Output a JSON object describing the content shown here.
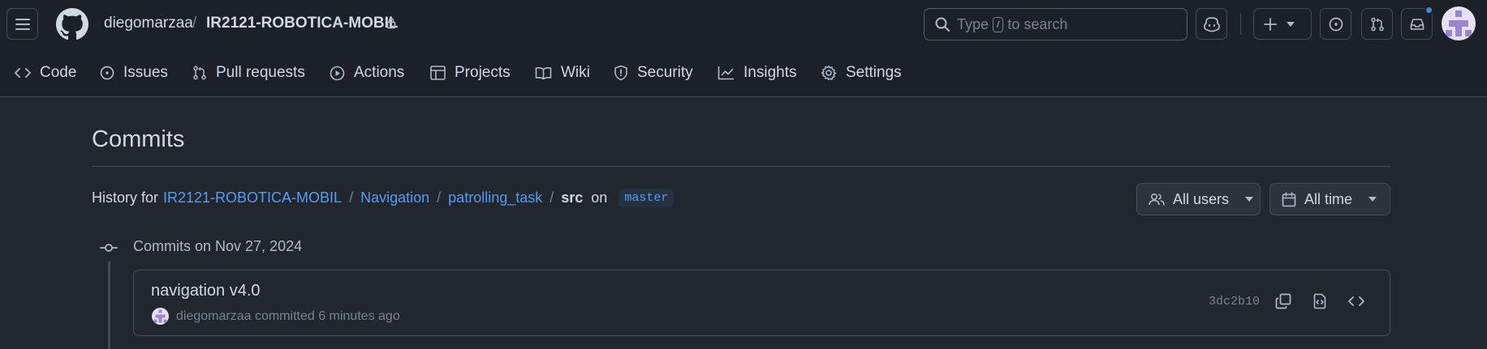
{
  "header": {
    "owner": "diegomarzaa",
    "separator": "/",
    "repo": "IR2121-ROBOTICA-MOBIL",
    "search_prefix": "Type",
    "search_key": "/",
    "search_suffix": "to search",
    "notification_dot_color": "#4184e4"
  },
  "nav": {
    "items": [
      {
        "label": "Code",
        "icon": "code-icon"
      },
      {
        "label": "Issues",
        "icon": "issue-icon"
      },
      {
        "label": "Pull requests",
        "icon": "pull-request-icon"
      },
      {
        "label": "Actions",
        "icon": "play-icon"
      },
      {
        "label": "Projects",
        "icon": "table-icon"
      },
      {
        "label": "Wiki",
        "icon": "book-icon"
      },
      {
        "label": "Security",
        "icon": "shield-icon"
      },
      {
        "label": "Insights",
        "icon": "graph-icon"
      },
      {
        "label": "Settings",
        "icon": "gear-icon"
      }
    ]
  },
  "page": {
    "title": "Commits",
    "history_prefix": "History for",
    "path": [
      "IR2121-ROBOTICA-MOBIL",
      "Navigation",
      "patrolling_task"
    ],
    "path_sep": "/",
    "current": "src",
    "on_label": "on",
    "branch": "master"
  },
  "filters": {
    "users_label": "All users",
    "time_label": "All time"
  },
  "commits": {
    "group_label": "Commits on Nov 27, 2024",
    "items": [
      {
        "message": "navigation v4.0",
        "author": "diegomarzaa",
        "action": "committed",
        "time": "6 minutes ago",
        "sha": "3dc2b10"
      }
    ]
  },
  "colors": {
    "background": "#22272e",
    "header": "#1c2128",
    "link": "#539bf5",
    "border": "#444c56",
    "text": "#cdd9e5"
  }
}
